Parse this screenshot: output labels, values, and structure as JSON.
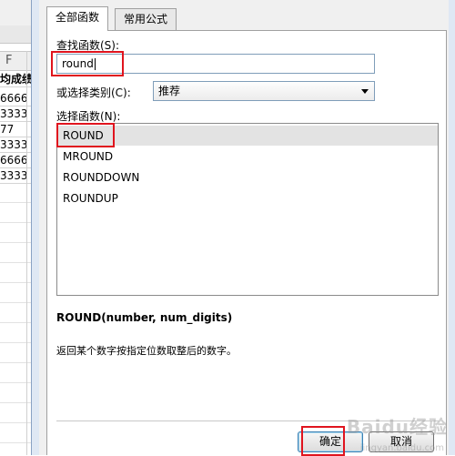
{
  "spreadsheet": {
    "column_letter": "F",
    "header_cell": "均成绩",
    "cells": [
      "6666",
      "3333",
      "77",
      "3333",
      "6666",
      "3333"
    ]
  },
  "dialog": {
    "tabs": [
      {
        "label": "全部函数",
        "active": true
      },
      {
        "label": "常用公式",
        "active": false
      }
    ],
    "search_label": "查找函数(S):",
    "search_value": "round",
    "category_label": "或选择类别(C):",
    "category_value": "推荐",
    "function_list_label": "选择函数(N):",
    "functions": [
      "ROUND",
      "MROUND",
      "ROUNDDOWN",
      "ROUNDUP"
    ],
    "selected_function": "ROUND",
    "syntax": "ROUND(number, num_digits)",
    "description": "返回某个数字按指定位数取整后的数字。",
    "ok_label": "确定",
    "cancel_label": "取消"
  },
  "colors": {
    "highlight": "#e0141e",
    "selected_row": "#e3e3e3",
    "dialog_frame": "#dfe8f4"
  },
  "watermark": {
    "text": "Baidu经验",
    "url": "jingyan.baidu.com"
  }
}
